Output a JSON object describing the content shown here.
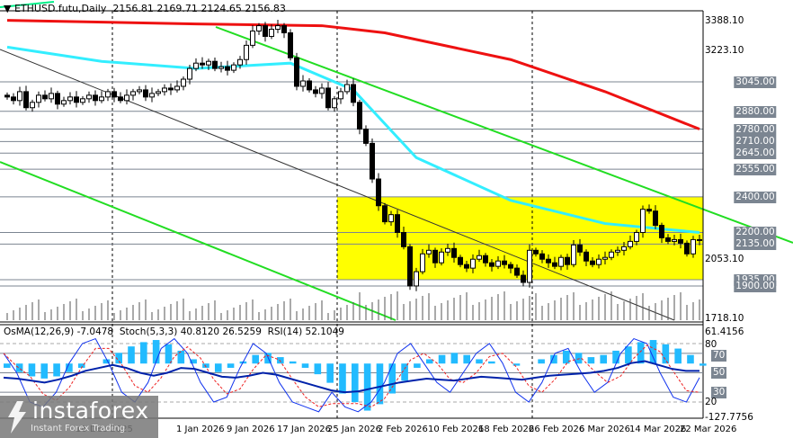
{
  "header": {
    "symbol": "ETHUSD.futu,Daily",
    "open": "2156.81",
    "high": "2169.71",
    "low": "2124.65",
    "close": "2156.83"
  },
  "indicator_header": {
    "osma": "OsMA(12,26,9) -7.0478",
    "stoch": "Stoch(5,3,3) 40.8120 26.5259",
    "rsi": "RSI(14) 52.1049"
  },
  "price_axis": [
    "3388.10",
    "3223.10",
    "2053.10",
    "1718.10"
  ],
  "price_axis_values": [
    3388.1,
    3223.1,
    2053.1,
    1718.1
  ],
  "levels": [
    {
      "label": "3045.00",
      "v": 3045
    },
    {
      "label": "2880.00",
      "v": 2880
    },
    {
      "label": "2780.00",
      "v": 2780
    },
    {
      "label": "2710.00",
      "v": 2710
    },
    {
      "label": "2645.00",
      "v": 2645
    },
    {
      "label": "2555.00",
      "v": 2555
    },
    {
      "label": "2400.00",
      "v": 2400
    },
    {
      "label": "2200.00",
      "v": 2200
    },
    {
      "label": "2135.00",
      "v": 2135
    },
    {
      "label": "1935.00",
      "v": 1935
    },
    {
      "label": "1900.00",
      "v": 1900
    }
  ],
  "indicator_axis": {
    "top": "61.4156",
    "bottom": "-127.7756",
    "s80": "80",
    "s20": "20",
    "l70": "70",
    "l50": "50",
    "l30": "30"
  },
  "dates": [
    {
      "label": "16 Dec 2025",
      "d": 12
    },
    {
      "label": "1 Jan 2026",
      "d": 28
    },
    {
      "label": "9 Jan 2026",
      "d": 36
    },
    {
      "label": "17 Jan 2026",
      "d": 44
    },
    {
      "label": "25 Jan 2026",
      "d": 52
    },
    {
      "label": "2 Feb 2026",
      "d": 60
    },
    {
      "label": "10 Feb 2026",
      "d": 68
    },
    {
      "label": "18 Feb 2026",
      "d": 76
    },
    {
      "label": "26 Feb 2026",
      "d": 84
    },
    {
      "label": "6 Mar 2026",
      "d": 92
    },
    {
      "label": "14 Mar 2026",
      "d": 100
    },
    {
      "label": "22 Mar 2026",
      "d": 108
    }
  ],
  "logo": {
    "name": "instaforex",
    "tagline": "Instant Forex Trading"
  },
  "chart_data": {
    "type": "candlestick",
    "ylim": [
      1718.1,
      3388.1
    ],
    "closes": [
      2960,
      2940,
      2990,
      2900,
      2930,
      2970,
      2950,
      2980,
      2920,
      2940,
      2960,
      2930,
      2950,
      2970,
      2940,
      2960,
      2990,
      2960,
      2940,
      2970,
      2990,
      3000,
      2960,
      2980,
      2990,
      3010,
      3000,
      3020,
      3060,
      3120,
      3150,
      3140,
      3160,
      3120,
      3130,
      3110,
      3140,
      3170,
      3250,
      3330,
      3360,
      3300,
      3340,
      3360,
      3320,
      3180,
      3020,
      3050,
      3000,
      2980,
      3010,
      2900,
      2950,
      2990,
      3030,
      2930,
      2780,
      2700,
      2500,
      2350,
      2260,
      2300,
      2200,
      2120,
      1900,
      1980,
      2080,
      2100,
      2030,
      2090,
      2110,
      2060,
      2020,
      2000,
      2050,
      2070,
      2030,
      2010,
      2040,
      2020,
      2000,
      1960,
      1920,
      2100,
      2080,
      2050,
      2030,
      2010,
      2060,
      2020,
      2130,
      2090,
      2040,
      2020,
      2050,
      2060,
      2090,
      2100,
      2120,
      2150,
      2200,
      2330,
      2320,
      2240,
      2170,
      2150,
      2160,
      2140,
      2080,
      2160,
      2157
    ],
    "ma_red": [
      [
        0,
        3390
      ],
      [
        30,
        3370
      ],
      [
        50,
        3360
      ],
      [
        60,
        3320
      ],
      [
        80,
        3170
      ],
      [
        95,
        2990
      ],
      [
        110,
        2780
      ]
    ],
    "ma_aqua": [
      [
        0,
        3240
      ],
      [
        15,
        3160
      ],
      [
        30,
        3120
      ],
      [
        45,
        3150
      ],
      [
        55,
        3000
      ],
      [
        65,
        2620
      ],
      [
        80,
        2380
      ],
      [
        95,
        2250
      ],
      [
        110,
        2200
      ]
    ],
    "osma": [
      -10,
      -20,
      -30,
      -35,
      -30,
      -20,
      -10,
      0,
      10,
      25,
      40,
      50,
      55,
      45,
      30,
      10,
      -10,
      -20,
      -10,
      5,
      20,
      25,
      15,
      5,
      -10,
      -25,
      -45,
      -70,
      -90,
      -110,
      -95,
      -70,
      -40,
      -10,
      10,
      20,
      25,
      20,
      10,
      5,
      0,
      -5,
      0,
      10,
      20,
      30,
      25,
      15,
      20,
      30,
      40,
      50,
      55,
      45,
      35,
      20,
      -5
    ],
    "stoch": [
      70,
      50,
      20,
      15,
      30,
      60,
      80,
      85,
      60,
      30,
      20,
      40,
      75,
      85,
      70,
      40,
      20,
      25,
      55,
      80,
      70,
      40,
      20,
      15,
      10,
      30,
      15,
      10,
      20,
      40,
      70,
      80,
      60,
      40,
      30,
      50,
      70,
      80,
      60,
      30,
      20,
      40,
      70,
      75,
      50,
      30,
      40,
      70,
      85,
      80,
      50,
      25,
      20,
      45
    ],
    "rsi": [
      45,
      44,
      42,
      40,
      43,
      47,
      52,
      55,
      58,
      55,
      50,
      47,
      50,
      55,
      54,
      50,
      46,
      45,
      47,
      50,
      48,
      44,
      40,
      36,
      32,
      30,
      31,
      34,
      37,
      40,
      42,
      44,
      43,
      42,
      44,
      46,
      45,
      44,
      43,
      45,
      47,
      48,
      49,
      50,
      52,
      55,
      60,
      62,
      58,
      54,
      52,
      52
    ]
  }
}
